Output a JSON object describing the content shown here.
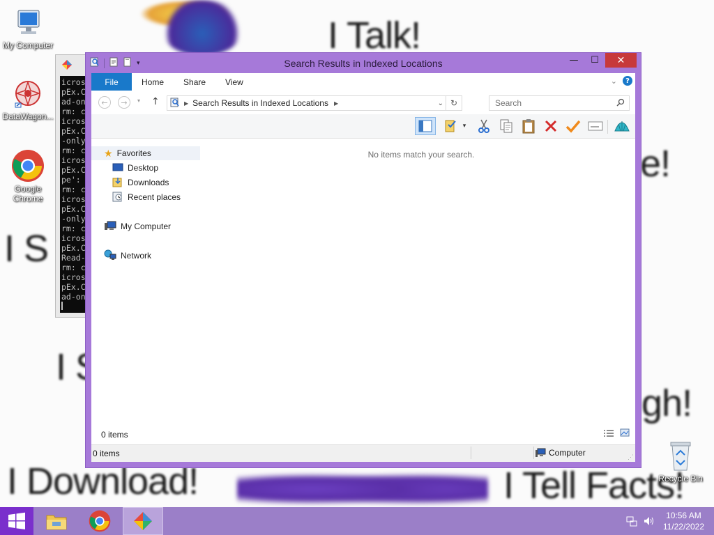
{
  "wallpaper": {
    "phrases": [
      "I Talk!",
      "e!",
      "I S",
      "I S",
      "gh!",
      "I Download!",
      "I Tell Facts!"
    ]
  },
  "desktop": {
    "icons": [
      {
        "label": "My Computer",
        "icon": "my-computer-icon"
      },
      {
        "label": "DataWagon...",
        "icon": "datawagon-icon"
      },
      {
        "label": "Google Chrome",
        "icon": "chrome-icon"
      },
      {
        "label": "Recycle Bin",
        "icon": "recycle-bin-icon"
      }
    ]
  },
  "console": {
    "lines": [
      "icros",
      "pEx.C",
      "ad-on",
      "rm: c",
      "icros",
      "pEx.C",
      "-only",
      "rm: c",
      "icros",
      "pEx.C",
      "pe':",
      "rm: c",
      "icros",
      "pEx.C",
      "-only",
      "rm: c",
      "icros",
      "pEx.C",
      "Read-",
      "rm: c",
      "icros",
      "pEx.C",
      "ad-on"
    ]
  },
  "explorer": {
    "title": "Search Results in Indexed Locations",
    "tabs": {
      "file": "File",
      "home": "Home",
      "share": "Share",
      "view": "View"
    },
    "address": {
      "path": "Search Results in Indexed Locations"
    },
    "search": {
      "placeholder": "Search"
    },
    "nav": {
      "favorites": "Favorites",
      "desktop": "Desktop",
      "downloads": "Downloads",
      "recent": "Recent places",
      "my_computer": "My Computer",
      "network": "Network"
    },
    "empty_message": "No items match your search.",
    "item_count": "0 items",
    "status": {
      "items": "0 items",
      "location": "Computer"
    }
  },
  "taskbar": {
    "time": "10:56 AM",
    "date": "11/22/2022"
  }
}
